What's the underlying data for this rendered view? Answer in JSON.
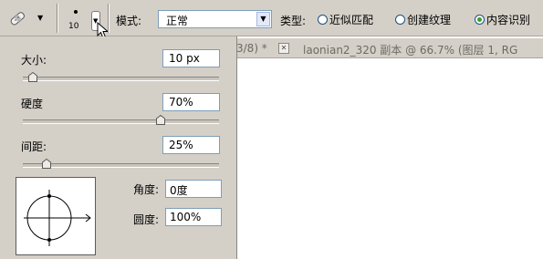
{
  "toolbar": {
    "brush_size": "10",
    "mode_label": "模式:",
    "mode_value": "正常",
    "type_label": "类型:",
    "radios": [
      {
        "label": "近似匹配",
        "selected": false
      },
      {
        "label": "创建纹理",
        "selected": false
      },
      {
        "label": "内容识别",
        "selected": true
      }
    ]
  },
  "doc_tab": {
    "left_text": "3/8) *",
    "close_icon": "close-icon",
    "right_text": "laonian2_320 副本 @ 66.7% (图层 1, RG"
  },
  "brush_panel": {
    "size_label": "大小:",
    "size_value": "10 px",
    "size_slider": 0.05,
    "hardness_label": "硬度",
    "hardness_value": "70%",
    "hardness_slider": 0.7,
    "spacing_label": "间距:",
    "spacing_value": "25%",
    "spacing_slider": 0.12,
    "angle_label": "角度:",
    "angle_value": "0度",
    "roundness_label": "圆度:",
    "roundness_value": "100%"
  }
}
